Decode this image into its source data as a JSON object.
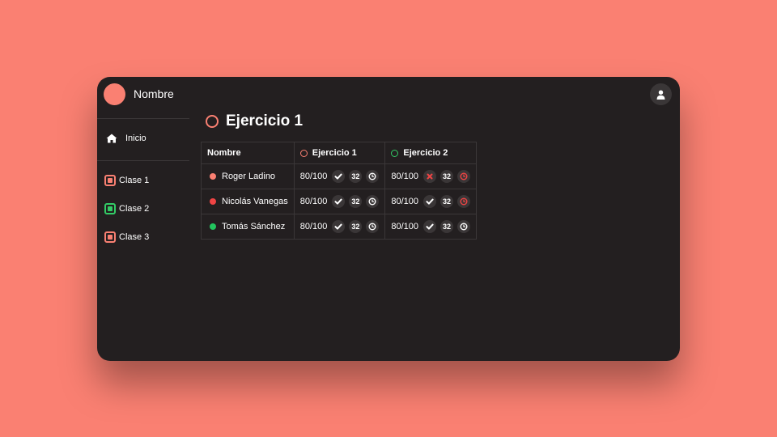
{
  "header": {
    "app_name": "Nombre",
    "user_icon": "user-icon"
  },
  "sidebar": {
    "home": {
      "label": "Inicio",
      "icon": "home-icon"
    },
    "classes": [
      {
        "label": "Clase 1",
        "color": "#fa8072"
      },
      {
        "label": "Clase 2",
        "color": "#33cc66"
      },
      {
        "label": "Clase 3",
        "color": "#fa8072"
      }
    ]
  },
  "main": {
    "title": "Ejercicio 1",
    "table": {
      "headers": [
        {
          "label": "Nombre"
        },
        {
          "label": "Ejercicio 1",
          "color": "#fa8072"
        },
        {
          "label": "Ejercicio 2",
          "color": "#33cc66"
        }
      ],
      "rows": [
        {
          "name": "Roger Ladino",
          "dot_color": "#fa8072",
          "ex1": {
            "score": "80/100",
            "status": "check",
            "count": "32",
            "clock": "#ffffff"
          },
          "ex2": {
            "score": "80/100",
            "status": "cross",
            "count": "32",
            "clock": "#ef4444"
          }
        },
        {
          "name": "Nicolás Vanegas",
          "dot_color": "#ef4444",
          "ex1": {
            "score": "80/100",
            "status": "check",
            "count": "32",
            "clock": "#ffffff"
          },
          "ex2": {
            "score": "80/100",
            "status": "check",
            "count": "32",
            "clock": "#ef4444"
          }
        },
        {
          "name": "Tomás Sánchez",
          "dot_color": "#22c55e",
          "ex1": {
            "score": "80/100",
            "status": "check",
            "count": "32",
            "clock": "#ffffff"
          },
          "ex2": {
            "score": "80/100",
            "status": "check",
            "count": "32",
            "clock": "#ffffff"
          }
        }
      ]
    }
  }
}
